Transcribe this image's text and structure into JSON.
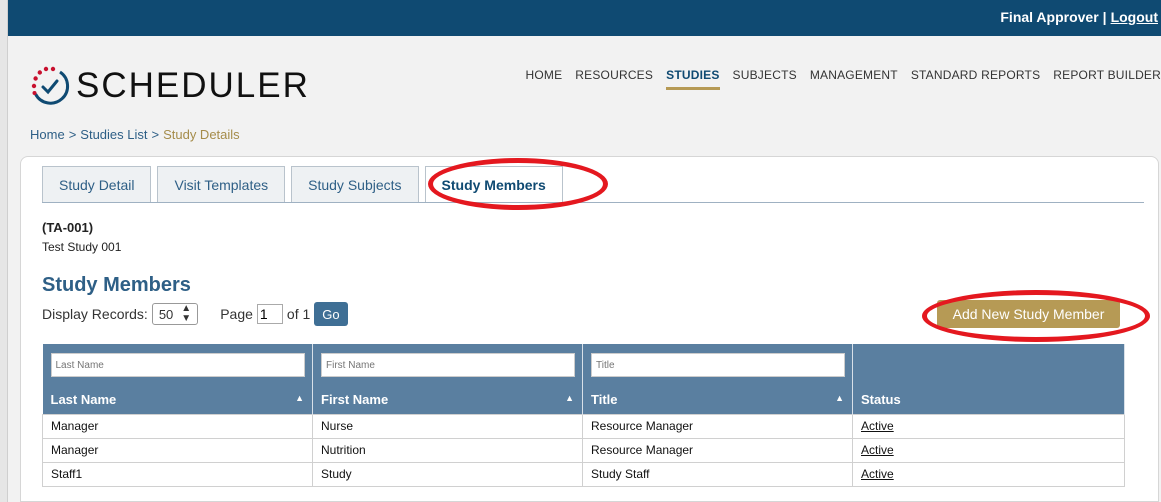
{
  "topbar": {
    "user_label": "Final Approver",
    "separator": "|",
    "logout_label": "Logout"
  },
  "logo": {
    "text": "SCHEDULER"
  },
  "nav": [
    "HOME",
    "RESOURCES",
    "STUDIES",
    "SUBJECTS",
    "MANAGEMENT",
    "STANDARD REPORTS",
    "REPORT BUILDER"
  ],
  "nav_active": "STUDIES",
  "breadcrumb": {
    "home": "Home",
    "sep": ">",
    "list": "Studies List",
    "current": "Study Details"
  },
  "tabs": [
    "Study Detail",
    "Visit Templates",
    "Study Subjects",
    "Study Members"
  ],
  "active_tab": "Study Members",
  "study": {
    "code": "(TA-001)",
    "name": "Test Study 001"
  },
  "section_title": "Study Members",
  "controls": {
    "display_label": "Display Records:",
    "records_value": "50",
    "page_label": "Page",
    "page_value": "1",
    "of_label": "of 1",
    "go_label": "Go"
  },
  "add_button_label": "Add New Study Member",
  "table": {
    "filters": [
      {
        "placeholder": "Last Name"
      },
      {
        "placeholder": "First Name"
      },
      {
        "placeholder": "Title"
      }
    ],
    "headers": [
      "Last Name",
      "First Name",
      "Title",
      "Status"
    ],
    "rows": [
      {
        "last": "Manager",
        "first": "Nurse",
        "title": "Resource Manager",
        "status": "Active"
      },
      {
        "last": "Manager",
        "first": "Nutrition",
        "title": "Resource Manager",
        "status": "Active"
      },
      {
        "last": "Staff1",
        "first": "Study",
        "title": "Study Staff",
        "status": "Active"
      }
    ]
  },
  "colors": {
    "topbar": "#0f4a72",
    "accent_gold": "#b69a55",
    "table_header": "#5a7fa0",
    "highlight": "#e4181f"
  }
}
